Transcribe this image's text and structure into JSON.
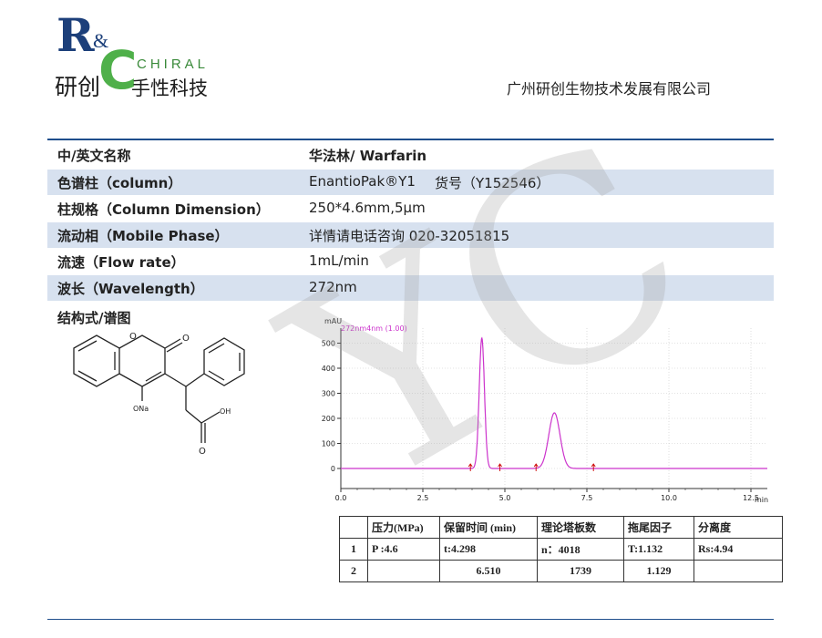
{
  "logo": {
    "r": "R",
    "amp": "&",
    "c": "C",
    "chiral": "CHIRAL",
    "cn_left": "研创",
    "cn_right": "手性科技"
  },
  "company": "广州研创生物技术发展有限公司",
  "info_rows": [
    {
      "key": "中/英文名称",
      "value": "华法林/ Warfarin"
    },
    {
      "key": "色谱柱（column）",
      "value": "EnantioPak®Y1",
      "value2": "货号（Y152546）"
    },
    {
      "key": "柱规格（Column Dimension）",
      "value": "250*4.6mm,5μm"
    },
    {
      "key": "流动相（Mobile Phase）",
      "value": "详情请电话咨询 020-32051815"
    },
    {
      "key": "流速（Flow rate）",
      "value": "1mL/min"
    },
    {
      "key": "波长（Wavelength）",
      "value": "272nm"
    }
  ],
  "structure_label": "结构式/谱图",
  "structure": {
    "o_label": "O",
    "ona_label": "ONa",
    "oh_label": "OH"
  },
  "watermark": "YC",
  "chart_data": {
    "type": "line",
    "trace_label": "272nm4nm (1.00)",
    "ylabel": "mAU",
    "xlabel": "min",
    "xlim": [
      0,
      13.0
    ],
    "ylim": [
      -80,
      560
    ],
    "x_ticks": [
      "0.0",
      "2.5",
      "5.0",
      "7.5",
      "10.0",
      "12.5"
    ],
    "x_tick_values": [
      0,
      2.5,
      5.0,
      7.5,
      10.0,
      12.5
    ],
    "y_ticks": [
      "500",
      "400",
      "300",
      "200",
      "100",
      "0"
    ],
    "y_tick_values": [
      500,
      400,
      300,
      200,
      100,
      0
    ],
    "grid": true,
    "line_color": "#cc33cc",
    "marker_color": "#cc0000",
    "peaks": [
      {
        "rt": 4.298,
        "height": 520,
        "width": 0.08
      },
      {
        "rt": 6.51,
        "height": 222,
        "width": 0.17
      }
    ],
    "integration_markers": [
      3.95,
      4.85,
      5.95,
      7.7
    ]
  },
  "results_table": {
    "header": [
      "",
      "压力(MPa)",
      "保留时间 (min)",
      "理论塔板数",
      "拖尾因子",
      "分离度"
    ],
    "rows": [
      [
        "1",
        "P :4.6",
        "t:4.298",
        "n：4018",
        "T:1.132",
        "Rs:4.94"
      ],
      [
        "2",
        "",
        "6.510",
        "1739",
        "1.129",
        ""
      ]
    ]
  }
}
